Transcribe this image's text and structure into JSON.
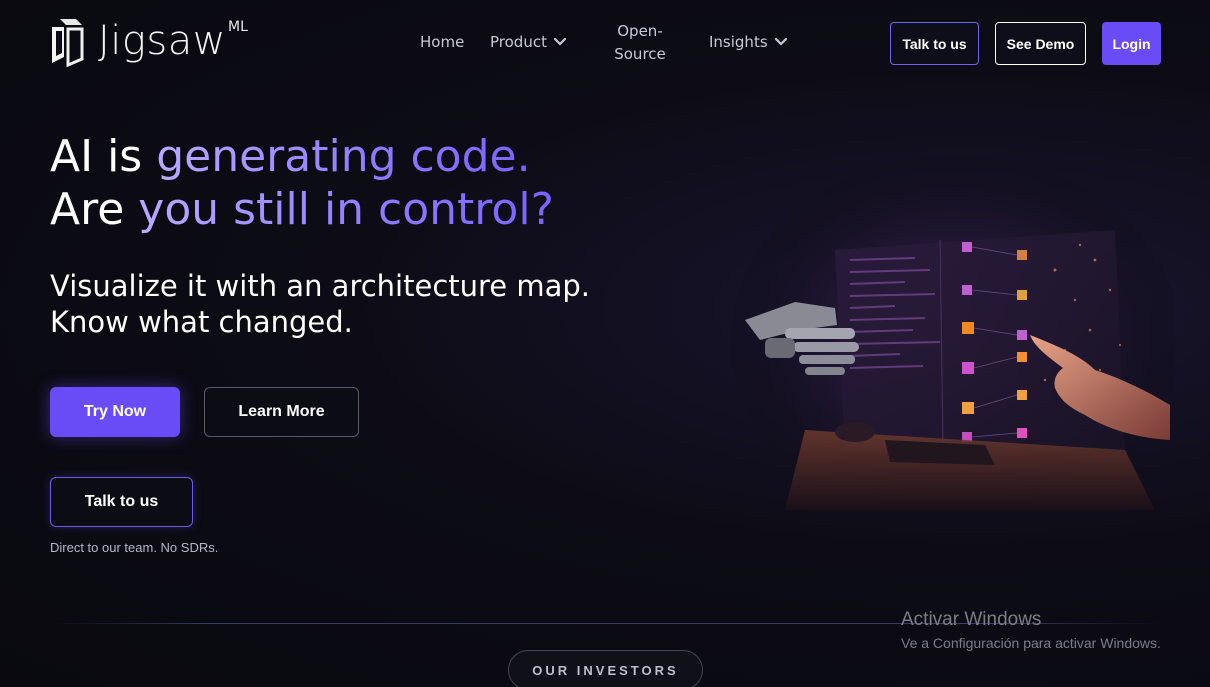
{
  "brand": {
    "name": "Jigsaw",
    "superscript": "ML"
  },
  "nav": {
    "home": "Home",
    "product": "Product",
    "open_source_line1": "Open-",
    "open_source_line2": "Source",
    "insights": "Insights"
  },
  "header_buttons": {
    "talk": "Talk to us",
    "demo": "See Demo",
    "login": "Login"
  },
  "hero": {
    "line1_white": "AI is ",
    "line1_accent": "generating code.",
    "line2_white": "Are ",
    "line2_accent": "you still in control?",
    "sub_line1": "Visualize it with an architecture map.",
    "sub_line2": "Know what changed.",
    "try_label": "Try Now",
    "learn_label": "Learn More",
    "talk_label": "Talk to us",
    "note": "Direct to our team. No SDRs."
  },
  "investors": {
    "label": "OUR INVESTORS"
  },
  "watermark": {
    "title": "Activar Windows",
    "subtitle": "Ve a Configuración para activar Windows."
  },
  "colors": {
    "accent": "#6a4cf7",
    "background": "#0b0b12",
    "accent_text": "#8d79ff"
  }
}
